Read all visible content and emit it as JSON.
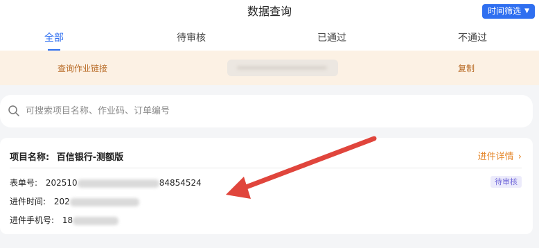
{
  "header": {
    "title": "数据查询",
    "filter_label": "时间筛选"
  },
  "tabs": [
    {
      "label": "全部"
    },
    {
      "label": "待审核"
    },
    {
      "label": "已通过"
    },
    {
      "label": "不通过"
    }
  ],
  "link_bar": {
    "label": "查询作业链接",
    "copy_label": "复制"
  },
  "search": {
    "placeholder": "可搜索项目名称、作业码、订单编号"
  },
  "card": {
    "project_label": "项目名称:",
    "project_name": "百信银行-测额版",
    "detail_link": "进件详情",
    "form_no_label": "表单号:",
    "form_no_prefix": "202510",
    "form_no_suffix": "84854524",
    "time_label": "进件时间:",
    "time_value": "202",
    "phone_label": "进件手机号:",
    "phone_prefix": "18",
    "status": "待审核"
  },
  "colors": {
    "primary": "#2f6ff0",
    "link_accent": "#b86a25",
    "detail_accent": "#e5892f",
    "badge_text": "#7168d9",
    "annotation_arrow": "#e0453c"
  }
}
